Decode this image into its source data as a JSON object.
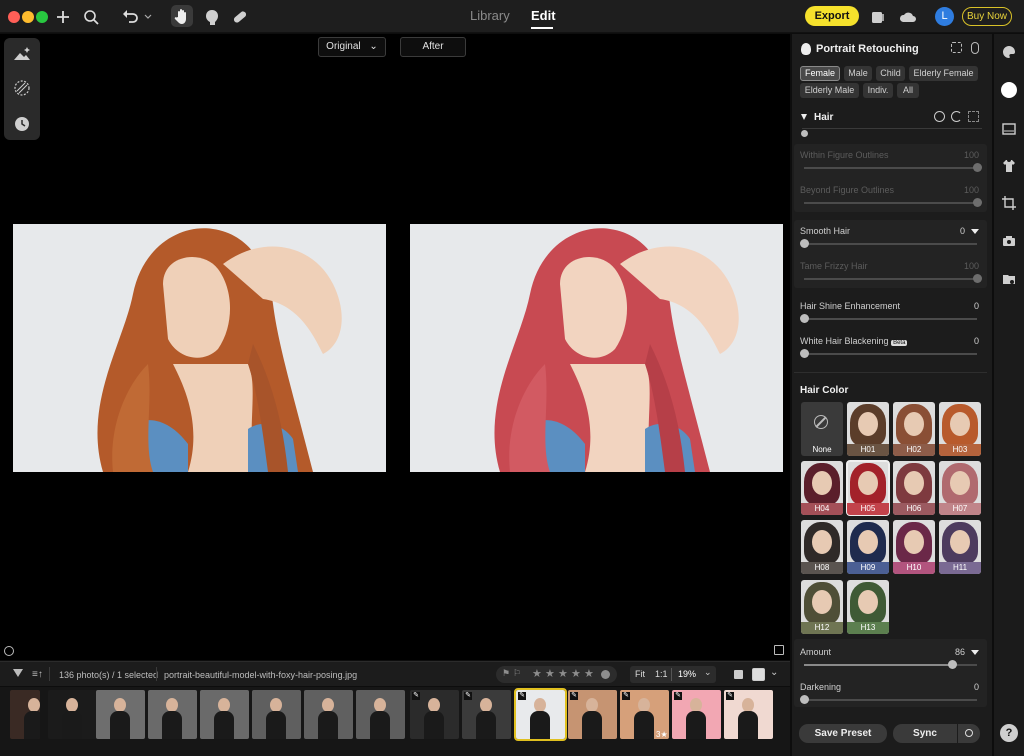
{
  "titlebar": {
    "tabs": [
      "Library",
      "Edit"
    ],
    "active_tab": "Edit",
    "export_label": "Export",
    "avatar_letter": "L",
    "buy_label": "Buy Now"
  },
  "canvas": {
    "compare_left": "Original",
    "compare_right": "After"
  },
  "panel": {
    "title": "Portrait Retouching",
    "chips": [
      "Female",
      "Male",
      "Child",
      "Elderly Female",
      "Elderly Male",
      "Indiv.",
      "All"
    ],
    "active_chip": "Female",
    "section": "Hair",
    "sliders": [
      {
        "label": "Within Figure Outlines",
        "value": "100",
        "level": 1.0,
        "dim": true
      },
      {
        "label": "Beyond Figure Outlines",
        "value": "100",
        "level": 1.0,
        "dim": true
      },
      {
        "label": "Smooth Hair",
        "value": "0",
        "level": 0.0,
        "dim": false
      },
      {
        "label": "Tame Frizzy Hair",
        "value": "100",
        "level": 1.0,
        "dim": true
      },
      {
        "label": "Hair Shine Enhancement",
        "value": "0",
        "level": 0.0,
        "dim": false
      },
      {
        "label": "White Hair Blackening",
        "badge": "Beta",
        "value": "0",
        "level": 0.0,
        "dim": false
      }
    ],
    "hair_color_title": "Hair Color",
    "swatches": [
      {
        "label": "None",
        "color": "#3a3a3a",
        "cap": "#3a3a3a"
      },
      {
        "label": "H01",
        "color": "#5b3d2a",
        "cap": "#6a5443"
      },
      {
        "label": "H02",
        "color": "#8a4f35",
        "cap": "#8d5c49"
      },
      {
        "label": "H03",
        "color": "#b85a2c",
        "cap": "#b5633c"
      },
      {
        "label": "H04",
        "color": "#5b1f2b",
        "cap": "#a45058"
      },
      {
        "label": "H05",
        "color": "#a3222a",
        "cap": "#c2434b"
      },
      {
        "label": "H06",
        "color": "#7e3a3f",
        "cap": "#9b5a60"
      },
      {
        "label": "H07",
        "color": "#b06a6f",
        "cap": "#c08489"
      },
      {
        "label": "H08",
        "color": "#2f2a28",
        "cap": "#5a5450"
      },
      {
        "label": "H09",
        "color": "#1f2b4e",
        "cap": "#4b5f94"
      },
      {
        "label": "H10",
        "color": "#6b2848",
        "cap": "#b2547e"
      },
      {
        "label": "H11",
        "color": "#4d3b5e",
        "cap": "#7a6a93"
      },
      {
        "label": "H12",
        "color": "#4f4f37",
        "cap": "#6f7553"
      },
      {
        "label": "H13",
        "color": "#3f5a35",
        "cap": "#5c7f4f"
      }
    ],
    "amount": {
      "label": "Amount",
      "value": "86",
      "level": 0.86
    },
    "darkening": {
      "label": "Darkening",
      "value": "0",
      "level": 0.0
    },
    "save_preset": "Save Preset",
    "sync": "Sync"
  },
  "filmbar": {
    "count": "136 photo(s) / 1 selected",
    "filename": "portrait-beautiful-model-with-foxy-hair-posing.jpg",
    "fit": "Fit",
    "one_to_one": "1:1",
    "zoom": "19%"
  },
  "filmstrip": {
    "selected_index": 10,
    "rated_label": "3★",
    "thumbs": [
      {
        "bg": "#3a2a24",
        "edited": false
      },
      {
        "bg": "#1b1b1b",
        "edited": false
      },
      {
        "bg": "#6e6e6e",
        "edited": false
      },
      {
        "bg": "#6a6a6a",
        "edited": false
      },
      {
        "bg": "#6a6a6a",
        "edited": false
      },
      {
        "bg": "#5f5f5f",
        "edited": false
      },
      {
        "bg": "#606060",
        "edited": false
      },
      {
        "bg": "#5e5e5e",
        "edited": false
      },
      {
        "bg": "#2b2b2b",
        "edited": true
      },
      {
        "bg": "#3b3b3b",
        "edited": true
      },
      {
        "bg": "#e8eaec",
        "edited": true
      },
      {
        "bg": "#c69472",
        "edited": true
      },
      {
        "bg": "#d6a07a",
        "edited": true
      },
      {
        "bg": "#f2a7b3",
        "edited": true
      },
      {
        "bg": "#f0d9d1",
        "edited": true
      }
    ]
  }
}
